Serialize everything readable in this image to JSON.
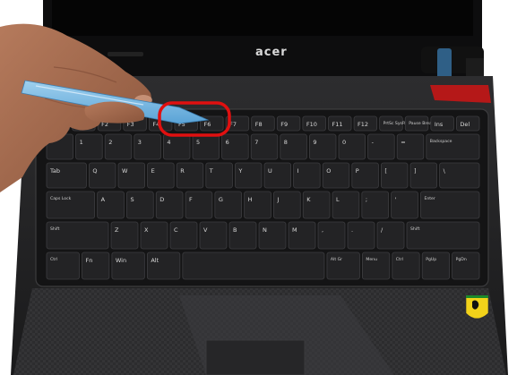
{
  "photo": {
    "subject": "laptop keyboard removal with plastic pry tool",
    "brand_logo": "acer",
    "badge": "ferrari-shield",
    "highlight_color": "#e01010"
  },
  "keyboard": {
    "row_fn": [
      "Esc",
      "F1",
      "F2",
      "F3",
      "F4",
      "F5",
      "F6",
      "F7",
      "F8",
      "F9",
      "F10",
      "F11",
      "F12",
      "PrtSc SysRq",
      "Pause Break",
      "Ins",
      "Del"
    ],
    "row_num": [
      "`",
      "1",
      "2",
      "3",
      "4",
      "5",
      "6",
      "7",
      "8",
      "9",
      "0",
      "-",
      "=",
      "Backspace"
    ],
    "row_q": [
      "Tab",
      "Q",
      "W",
      "E",
      "R",
      "T",
      "Y",
      "U",
      "I",
      "O",
      "P",
      "[",
      "]",
      "\\"
    ],
    "row_a": [
      "Caps Lock",
      "A",
      "S",
      "D",
      "F",
      "G",
      "H",
      "J",
      "K",
      "L",
      ";",
      "'",
      "Enter"
    ],
    "row_z": [
      "Shift",
      "Z",
      "X",
      "C",
      "V",
      "B",
      "N",
      "M",
      ",",
      ".",
      "/",
      "Shift"
    ],
    "row_bottom": [
      "Ctrl",
      "Fn",
      "Win",
      "Alt",
      "",
      "Alt Gr",
      "Menu",
      "Ctrl",
      "PgUp",
      "PgDn"
    ]
  }
}
